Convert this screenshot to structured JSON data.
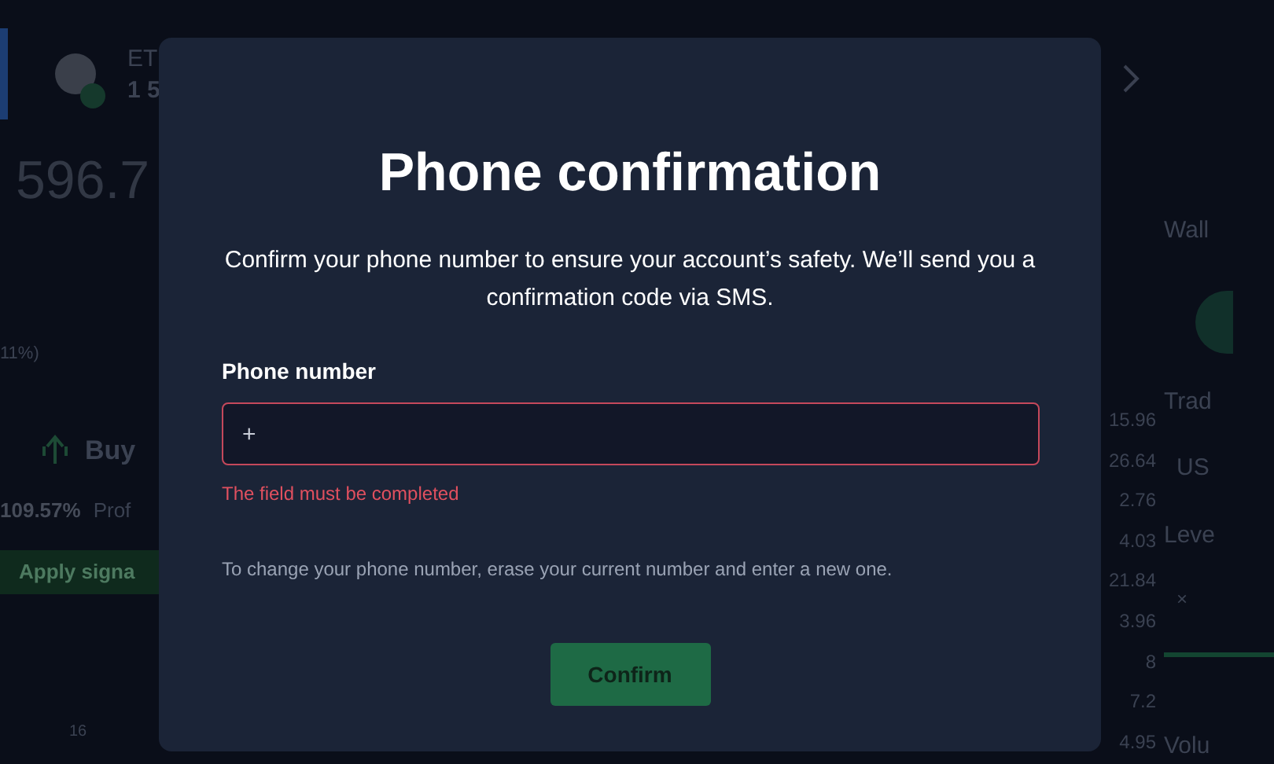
{
  "backdrop": {
    "asset_tab": {
      "symbol": "ET",
      "amount": "1 5",
      "selected": true
    },
    "price": "596.7",
    "change": "11%)",
    "signal": {
      "direction": "Buy",
      "profit": "109.57%",
      "profit_label": "Prof",
      "button": "Apply signa"
    },
    "axis_label": "16",
    "column_values": [
      "15.96",
      "26.64",
      "2.76",
      "4.03",
      "21.84",
      "3.96",
      "8",
      "7.2",
      "4.95"
    ],
    "side_panel": {
      "wallet_label": "Wall",
      "trade_label": "Trad",
      "trade_value": "US",
      "leverage_label": "Leve",
      "leverage_symbol": "×",
      "volume_label": "Volu"
    }
  },
  "modal": {
    "title": "Phone confirmation",
    "description": "Confirm your phone number to ensure your account’s safety. We’ll send you a confirmation code via SMS.",
    "field": {
      "label": "Phone number",
      "value": "+",
      "invalid": true,
      "error": "The field must be completed"
    },
    "hint": "To change your phone number, erase your current number and enter a new one.",
    "button": "Confirm"
  }
}
